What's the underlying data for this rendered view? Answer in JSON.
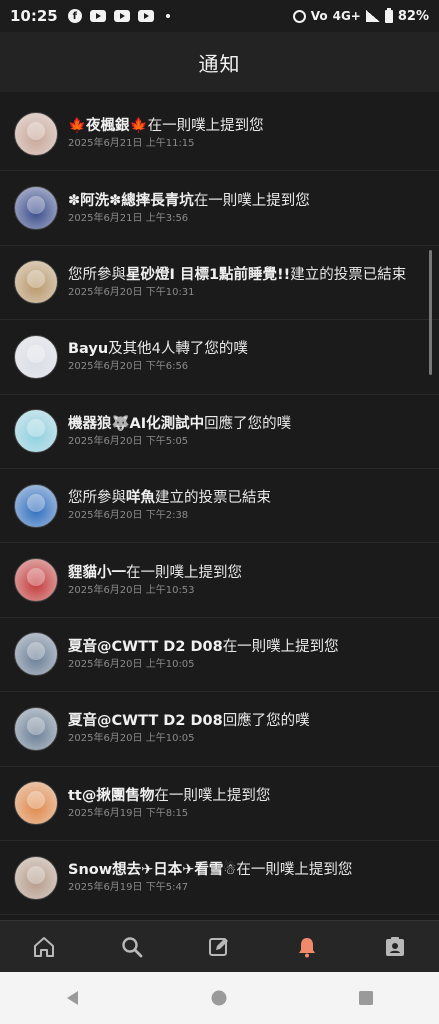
{
  "status_bar": {
    "time": "10:25",
    "network": "4G+",
    "volte": "Vo",
    "battery": "82%",
    "apps": [
      "facebook-icon",
      "youtube-icon",
      "youtube-icon",
      "youtube-icon"
    ]
  },
  "header": {
    "title": "通知"
  },
  "notifications": [
    {
      "name": "🍁夜楓銀🍁",
      "action": "在一則噗上提到您",
      "time": "2025年6月21日 上午11:15",
      "avatar_color": "#c9a79a"
    },
    {
      "name": "✽阿洗✽總摔長青坑",
      "action": "在一則噗上提到您",
      "time": "2025年6月21日 上午3:56",
      "avatar_color": "#3a4c8c"
    },
    {
      "name": "",
      "action_prefix": "您所參與",
      "name2": "星砂燈I 目標1點前睡覺!!",
      "action": "建立的投票已結束",
      "time": "2025年6月20日 下午10:31",
      "avatar_color": "#b9986a"
    },
    {
      "name": "Bayu",
      "action": "及其他4人轉了您的噗",
      "time": "2025年6月20日 下午6:56",
      "avatar_color": "#d9dde6"
    },
    {
      "name": "機器狼🐺AI化測試中",
      "action": "回應了您的噗",
      "time": "2025年6月20日 下午5:05",
      "avatar_color": "#8fd0e0"
    },
    {
      "name": "",
      "action_prefix": "您所參與",
      "name2": "咩魚",
      "action": "建立的投票已結束",
      "time": "2025年6月20日 下午2:38",
      "avatar_color": "#2f6fbf"
    },
    {
      "name": "貍貓小一",
      "action": "在一則噗上提到您",
      "time": "2025年6月20日 上午10:53",
      "avatar_color": "#c43b3b"
    },
    {
      "name": "夏音@CWTT D2 D08",
      "action": "在一則噗上提到您",
      "time": "2025年6月20日 上午10:05",
      "avatar_color": "#6b7f96"
    },
    {
      "name": "夏音@CWTT D2 D08",
      "action": "回應了您的噗",
      "time": "2025年6月20日 上午10:05",
      "avatar_color": "#6b7f96"
    },
    {
      "name": "tt@揪團售物",
      "action": "在一則噗上提到您",
      "time": "2025年6月19日 下午8:15",
      "avatar_color": "#e0894a"
    },
    {
      "name": "Snow想去✈日本✈看雪☃",
      "action": "在一則噗上提到您",
      "time": "2025年6月19日 下午5:47",
      "avatar_color": "#b59b8a"
    }
  ],
  "tabs": [
    {
      "icon": "home-icon",
      "active": false
    },
    {
      "icon": "search-icon",
      "active": false
    },
    {
      "icon": "compose-icon",
      "active": false
    },
    {
      "icon": "bell-icon",
      "active": true
    },
    {
      "icon": "profile-icon",
      "active": false
    }
  ],
  "colors": {
    "accent": "#f08a6a",
    "icon": "#b8b8b8",
    "background": "#1b1b1b"
  },
  "system_nav": [
    "back-icon",
    "home-circle-icon",
    "recents-icon"
  ]
}
